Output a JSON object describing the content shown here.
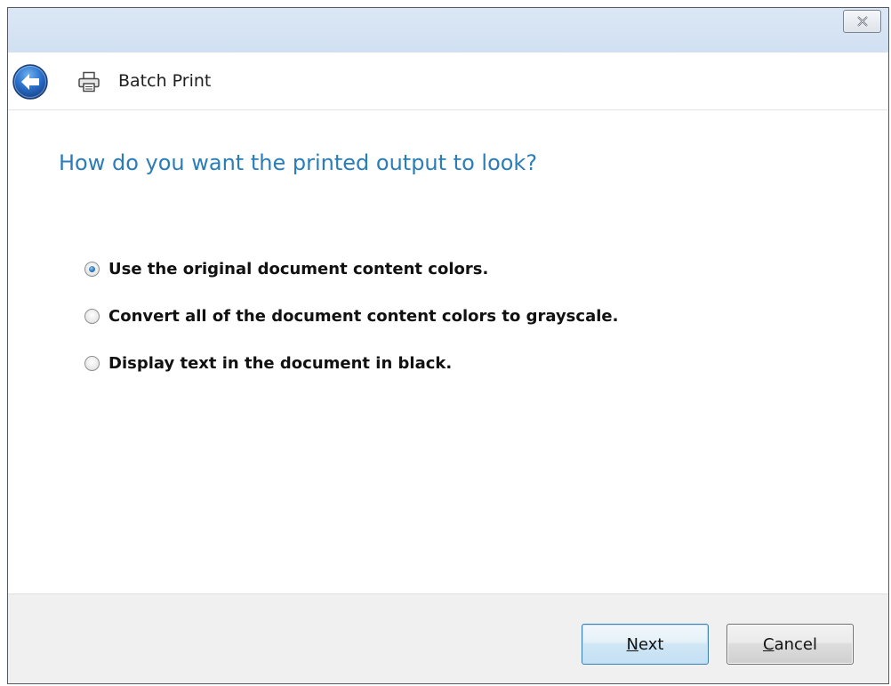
{
  "window": {
    "title": "Batch Print",
    "close_icon": "close-icon"
  },
  "nav": {
    "back_icon": "back-arrow-icon",
    "app_icon": "printer-icon",
    "title": "Batch Print"
  },
  "content": {
    "heading": "How do you want the printed output to look?",
    "options": [
      {
        "label": "Use the original document content colors.",
        "selected": true
      },
      {
        "label": "Convert all of the document content colors to grayscale.",
        "selected": false
      },
      {
        "label": "Display text in the document in black.",
        "selected": false
      }
    ]
  },
  "footer": {
    "next": {
      "accel": "N",
      "rest": "ext"
    },
    "cancel": {
      "accel": "C",
      "rest": "ancel"
    }
  },
  "colors": {
    "heading": "#2a7db8",
    "titlebar": "#d1e0f2",
    "footer": "#f0f0f0",
    "back_button": "#2a6fc9"
  }
}
